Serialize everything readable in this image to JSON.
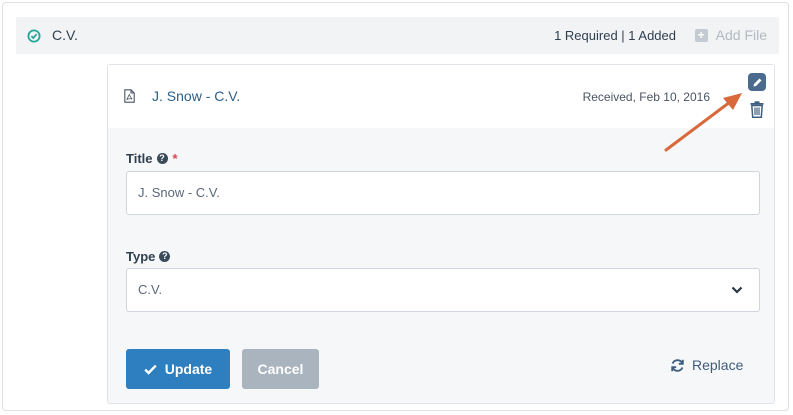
{
  "section": {
    "title": "C.V.",
    "requirement_status": "1 Required | 1 Added",
    "add_file_label": "Add File"
  },
  "file": {
    "name": "J. Snow - C.V.",
    "received": "Received, Feb 10, 2016"
  },
  "form": {
    "title_label": "Title",
    "required_marker": "*",
    "title_value": "J. Snow - C.V.",
    "type_label": "Type",
    "type_value": "C.V."
  },
  "actions": {
    "update_label": "Update",
    "cancel_label": "Cancel",
    "replace_label": "Replace"
  },
  "colors": {
    "primary": "#2e7fbf",
    "secondary": "#a9b4be",
    "success": "#26a69a",
    "annotation_arrow": "#d9683a"
  },
  "icons": [
    "check-circle-icon",
    "plus-square-icon",
    "file-pdf-icon",
    "pencil-icon",
    "trash-icon",
    "help-circle-icon",
    "chevron-down-icon",
    "check-icon",
    "refresh-icon"
  ]
}
